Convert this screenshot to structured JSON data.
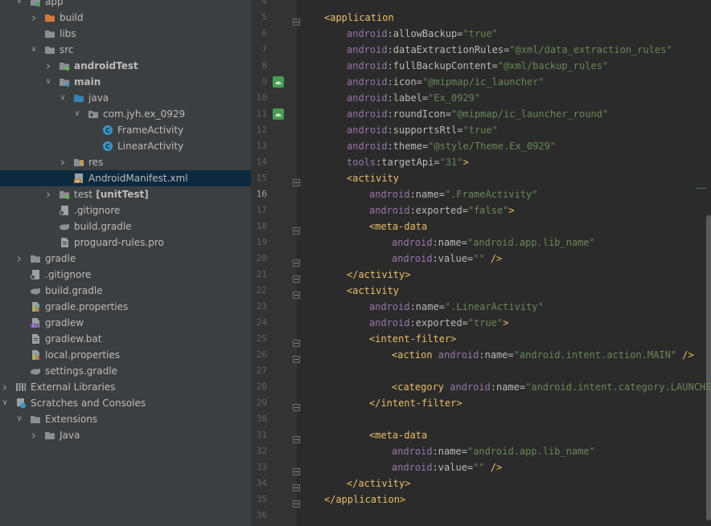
{
  "project_tree": [
    {
      "label": "app",
      "arrow": "down",
      "icon": "module-folder-icon",
      "indent": 0
    },
    {
      "label": "build",
      "arrow": "right",
      "icon": "excluded-folder-icon",
      "indent": 1
    },
    {
      "label": "libs",
      "arrow": "",
      "icon": "folder-icon",
      "indent": 1
    },
    {
      "label": "src",
      "arrow": "down",
      "icon": "folder-icon",
      "indent": 1
    },
    {
      "label": "androidTest",
      "arrow": "right",
      "icon": "test-folder-icon",
      "indent": 2,
      "bold": true
    },
    {
      "label": "main",
      "arrow": "down",
      "icon": "source-folder-icon",
      "indent": 2,
      "bold": true
    },
    {
      "label": "java",
      "arrow": "down",
      "icon": "source-root-icon",
      "indent": 3
    },
    {
      "label": "com.jyh.ex_0929",
      "arrow": "down",
      "icon": "package-icon",
      "indent": 4
    },
    {
      "label": "FrameActivity",
      "arrow": "",
      "icon": "java-class-icon",
      "indent": 5
    },
    {
      "label": "LinearActivity",
      "arrow": "",
      "icon": "java-class-icon",
      "indent": 5
    },
    {
      "label": "res",
      "arrow": "right",
      "icon": "resources-folder-icon",
      "indent": 3
    },
    {
      "label": "AndroidManifest.xml",
      "arrow": "",
      "icon": "manifest-file-icon",
      "indent": 3,
      "selected": true
    },
    {
      "label": "test",
      "suffix": "[unitTest]",
      "arrow": "right",
      "icon": "test-folder-icon",
      "indent": 2
    },
    {
      "label": ".gitignore",
      "arrow": "",
      "icon": "gitignore-file-icon",
      "indent": 2
    },
    {
      "label": "build.gradle",
      "arrow": "",
      "icon": "gradle-file-icon",
      "indent": 2
    },
    {
      "label": "proguard-rules.pro",
      "arrow": "",
      "icon": "text-file-icon",
      "indent": 2
    },
    {
      "label": "gradle",
      "arrow": "right",
      "icon": "folder-icon",
      "indent": 0
    },
    {
      "label": ".gitignore",
      "arrow": "",
      "icon": "gitignore-file-icon",
      "indent": 0
    },
    {
      "label": "build.gradle",
      "arrow": "",
      "icon": "gradle-file-icon",
      "indent": 0
    },
    {
      "label": "gradle.properties",
      "arrow": "",
      "icon": "properties-file-icon",
      "indent": 0
    },
    {
      "label": "gradlew",
      "arrow": "",
      "icon": "shell-script-icon",
      "indent": 0
    },
    {
      "label": "gradlew.bat",
      "arrow": "",
      "icon": "text-file-icon",
      "indent": 0
    },
    {
      "label": "local.properties",
      "arrow": "",
      "icon": "properties-file-icon",
      "indent": 0
    },
    {
      "label": "settings.gradle",
      "arrow": "",
      "icon": "gradle-file-icon",
      "indent": 0
    },
    {
      "label": "External Libraries",
      "arrow": "right",
      "icon": "library-icon",
      "indent": -1
    },
    {
      "label": "Scratches and Consoles",
      "arrow": "down",
      "icon": "scratches-icon",
      "indent": -1
    },
    {
      "label": "Extensions",
      "arrow": "down",
      "icon": "folder-icon",
      "indent": 0
    },
    {
      "label": "Java",
      "arrow": "right",
      "icon": "folder-icon",
      "indent": 1
    }
  ],
  "editor": {
    "current_line": "16",
    "lines": [
      {
        "n": "4",
        "tokens": []
      },
      {
        "n": "5",
        "indent": 0,
        "tokens": [
          [
            "tag",
            "<application"
          ]
        ]
      },
      {
        "n": "6",
        "indent": 1,
        "tokens": [
          [
            "ns",
            "android"
          ],
          [
            "attr",
            ":allowBackup="
          ],
          [
            "str",
            "\"true\""
          ]
        ]
      },
      {
        "n": "7",
        "indent": 1,
        "tokens": [
          [
            "ns",
            "android"
          ],
          [
            "attr",
            ":dataExtractionRules="
          ],
          [
            "str",
            "\"@xml/data_extraction_rules\""
          ]
        ]
      },
      {
        "n": "8",
        "indent": 1,
        "tokens": [
          [
            "ns",
            "android"
          ],
          [
            "attr",
            ":fullBackupContent="
          ],
          [
            "str",
            "\"@xml/backup_rules\""
          ]
        ]
      },
      {
        "n": "9",
        "indent": 1,
        "tokens": [
          [
            "ns",
            "android"
          ],
          [
            "attr",
            ":icon="
          ],
          [
            "str",
            "\"@mipmap/ic_launcher\""
          ]
        ]
      },
      {
        "n": "10",
        "indent": 1,
        "tokens": [
          [
            "ns",
            "android"
          ],
          [
            "attr",
            ":label="
          ],
          [
            "str",
            "\"Ex_0929\""
          ]
        ]
      },
      {
        "n": "11",
        "indent": 1,
        "tokens": [
          [
            "ns",
            "android"
          ],
          [
            "attr",
            ":roundIcon="
          ],
          [
            "str",
            "\"@mipmap/ic_launcher_round\""
          ]
        ]
      },
      {
        "n": "12",
        "indent": 1,
        "tokens": [
          [
            "ns",
            "android"
          ],
          [
            "attr",
            ":supportsRtl="
          ],
          [
            "str",
            "\"true\""
          ]
        ]
      },
      {
        "n": "13",
        "indent": 1,
        "tokens": [
          [
            "ns",
            "android"
          ],
          [
            "attr",
            ":theme="
          ],
          [
            "str",
            "\"@style/Theme.Ex_0929\""
          ]
        ]
      },
      {
        "n": "14",
        "indent": 1,
        "tokens": [
          [
            "ns",
            "tools"
          ],
          [
            "attr",
            ":targetApi="
          ],
          [
            "str",
            "\"31\""
          ],
          [
            "tag",
            ">"
          ]
        ]
      },
      {
        "n": "15",
        "indent": 1,
        "tokens": [
          [
            "tag",
            "<activity"
          ]
        ]
      },
      {
        "n": "16",
        "indent": 2,
        "tokens": [
          [
            "ns",
            "android"
          ],
          [
            "attr",
            ":name="
          ],
          [
            "str",
            "\".FrameActivity\""
          ]
        ]
      },
      {
        "n": "17",
        "indent": 2,
        "tokens": [
          [
            "ns",
            "android"
          ],
          [
            "attr",
            ":exported="
          ],
          [
            "str",
            "\"false\""
          ],
          [
            "tag",
            ">"
          ]
        ]
      },
      {
        "n": "18",
        "indent": 2,
        "tokens": [
          [
            "tag",
            "<meta-data"
          ]
        ]
      },
      {
        "n": "19",
        "indent": 3,
        "tokens": [
          [
            "ns",
            "android"
          ],
          [
            "attr",
            ":name="
          ],
          [
            "str",
            "\"android.app.lib_name\""
          ]
        ]
      },
      {
        "n": "20",
        "indent": 3,
        "tokens": [
          [
            "ns",
            "android"
          ],
          [
            "attr",
            ":value="
          ],
          [
            "str",
            "\"\""
          ],
          [
            "tag",
            " />"
          ]
        ]
      },
      {
        "n": "21",
        "indent": 1,
        "tokens": [
          [
            "tag",
            "</activity>"
          ]
        ]
      },
      {
        "n": "22",
        "indent": 1,
        "tokens": [
          [
            "tag",
            "<activity"
          ]
        ]
      },
      {
        "n": "23",
        "indent": 2,
        "tokens": [
          [
            "ns",
            "android"
          ],
          [
            "attr",
            ":name="
          ],
          [
            "str",
            "\".LinearActivity\""
          ]
        ]
      },
      {
        "n": "24",
        "indent": 2,
        "tokens": [
          [
            "ns",
            "android"
          ],
          [
            "attr",
            ":exported="
          ],
          [
            "str",
            "\"true\""
          ],
          [
            "tag",
            ">"
          ]
        ]
      },
      {
        "n": "25",
        "indent": 2,
        "tokens": [
          [
            "tag",
            "<intent-filter>"
          ]
        ]
      },
      {
        "n": "26",
        "indent": 3,
        "tokens": [
          [
            "tag",
            "<action "
          ],
          [
            "ns",
            "android"
          ],
          [
            "attr",
            ":name="
          ],
          [
            "str",
            "\"android.intent.action.MAIN\""
          ],
          [
            "tag",
            " />"
          ]
        ]
      },
      {
        "n": "27",
        "tokens": []
      },
      {
        "n": "28",
        "indent": 3,
        "tokens": [
          [
            "tag",
            "<category "
          ],
          [
            "ns",
            "android"
          ],
          [
            "attr",
            ":name="
          ],
          [
            "str",
            "\"android.intent.category.LAUNCHER\""
          ]
        ]
      },
      {
        "n": "29",
        "indent": 2,
        "tokens": [
          [
            "tag",
            "</intent-filter>"
          ]
        ]
      },
      {
        "n": "30",
        "tokens": []
      },
      {
        "n": "31",
        "indent": 2,
        "tokens": [
          [
            "tag",
            "<meta-data"
          ]
        ]
      },
      {
        "n": "32",
        "indent": 3,
        "tokens": [
          [
            "ns",
            "android"
          ],
          [
            "attr",
            ":name="
          ],
          [
            "str",
            "\"android.app.lib_name\""
          ]
        ]
      },
      {
        "n": "33",
        "indent": 3,
        "tokens": [
          [
            "ns",
            "android"
          ],
          [
            "attr",
            ":value="
          ],
          [
            "str",
            "\"\""
          ],
          [
            "tag",
            " />"
          ]
        ]
      },
      {
        "n": "34",
        "indent": 1,
        "tokens": [
          [
            "tag",
            "</activity>"
          ]
        ]
      },
      {
        "n": "35",
        "indent": 0,
        "tokens": [
          [
            "tag",
            "</application>"
          ]
        ]
      },
      {
        "n": "36",
        "tokens": []
      }
    ],
    "gutter_icons": [
      {
        "line": "9",
        "icon": "android-icon"
      },
      {
        "line": "11",
        "icon": "android-icon"
      }
    ],
    "fold_markers": [
      "5",
      "15",
      "18",
      "20",
      "21",
      "22",
      "25",
      "26",
      "29",
      "31",
      "33",
      "34",
      "35"
    ]
  },
  "colors": {
    "tree_bg": "#3c3f41",
    "editor_bg": "#2b2b2b",
    "tag": "#e8bf6a",
    "namespace": "#9876aa",
    "string": "#6a8759",
    "selection": "#0d293e"
  }
}
